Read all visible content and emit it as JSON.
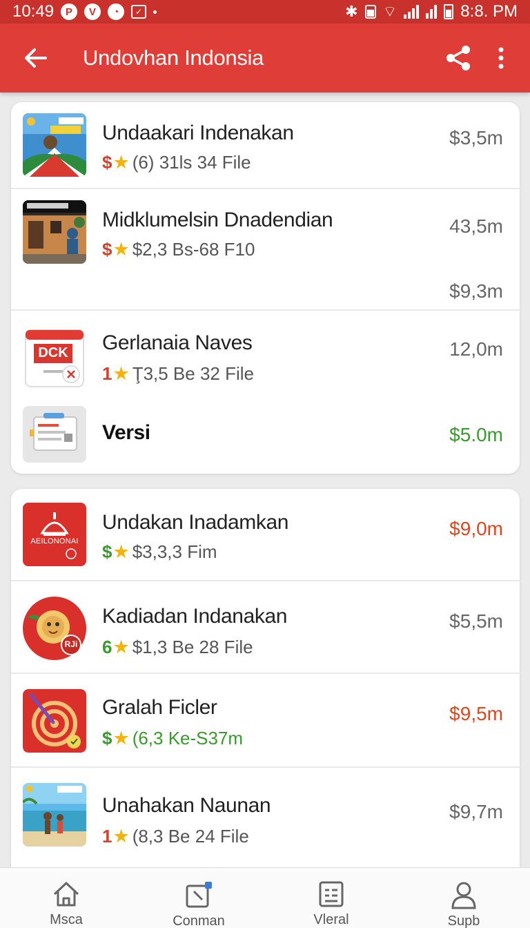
{
  "status_bar": {
    "time": "10:49",
    "right_time": "8:8. PM",
    "icons": [
      "p-icon",
      "v-icon",
      "chart-icon",
      "check-box-icon"
    ]
  },
  "app_bar": {
    "title": "Undovhan Indonsia",
    "back_icon": "arrow-left-icon",
    "share_icon": "share-icon",
    "more_icon": "more-vertical-icon"
  },
  "card1": {
    "items": [
      {
        "title": "Undaakari Indenakan",
        "meta_prefix": "$",
        "meta_text": "(6) 31ls 34 File",
        "price": "$3,5m",
        "thumb": "festival-photo"
      },
      {
        "title": "Midklumelsin Dnadendian",
        "meta_prefix": "$",
        "meta_text": "$2,3 Bs-68 F10",
        "price": "43,5m",
        "price2": "$9,3m",
        "thumb": "house-photo"
      },
      {
        "title": "Gerlanaia Naves",
        "meta_prefix": "1",
        "meta_text": "Ţ3,5 Be 32 File",
        "price": "12,0m",
        "thumb": "dck-calendar-icon",
        "thumb_label": "DCK"
      },
      {
        "title": "Versi",
        "price": "$5.0m",
        "thumb": "document-icon"
      }
    ]
  },
  "card2": {
    "items": [
      {
        "title": "Undakan Inadamkan",
        "meta_prefix": "$",
        "meta_text": "$3,3,3 Fim",
        "price": "$9,0m",
        "thumb": "mosque-logo",
        "thumb_label": "AEILONONAI"
      },
      {
        "title": "Kadiadan Indanakan",
        "meta_prefix": "6",
        "meta_text": "$1,3 Be 28 File",
        "price": "$5,5m",
        "thumb": "mascot-icon",
        "thumb_label": "RJi"
      },
      {
        "title": "Gralah Ficler",
        "meta_prefix": "$",
        "meta_text": "(6,3 Ke-S37m",
        "price": "$9,5m",
        "thumb": "target-icon"
      },
      {
        "title": "Unahakan Naunan",
        "meta_prefix": "1",
        "meta_text": "(8,3 Be 24 File",
        "price": "$9,7m",
        "thumb": "beach-photo"
      }
    ]
  },
  "bottom_nav": {
    "items": [
      {
        "label": "Msca",
        "icon": "home-icon"
      },
      {
        "label": "Conman",
        "icon": "edit-icon"
      },
      {
        "label": "Vleral",
        "icon": "list-icon"
      },
      {
        "label": "Supb",
        "icon": "person-icon"
      }
    ]
  },
  "colors": {
    "app_bar": "#df3e38",
    "status_bar": "#c8312c",
    "price_red": "#d9481f",
    "price_green": "#3a9a2e",
    "star": "#f1b40c"
  }
}
